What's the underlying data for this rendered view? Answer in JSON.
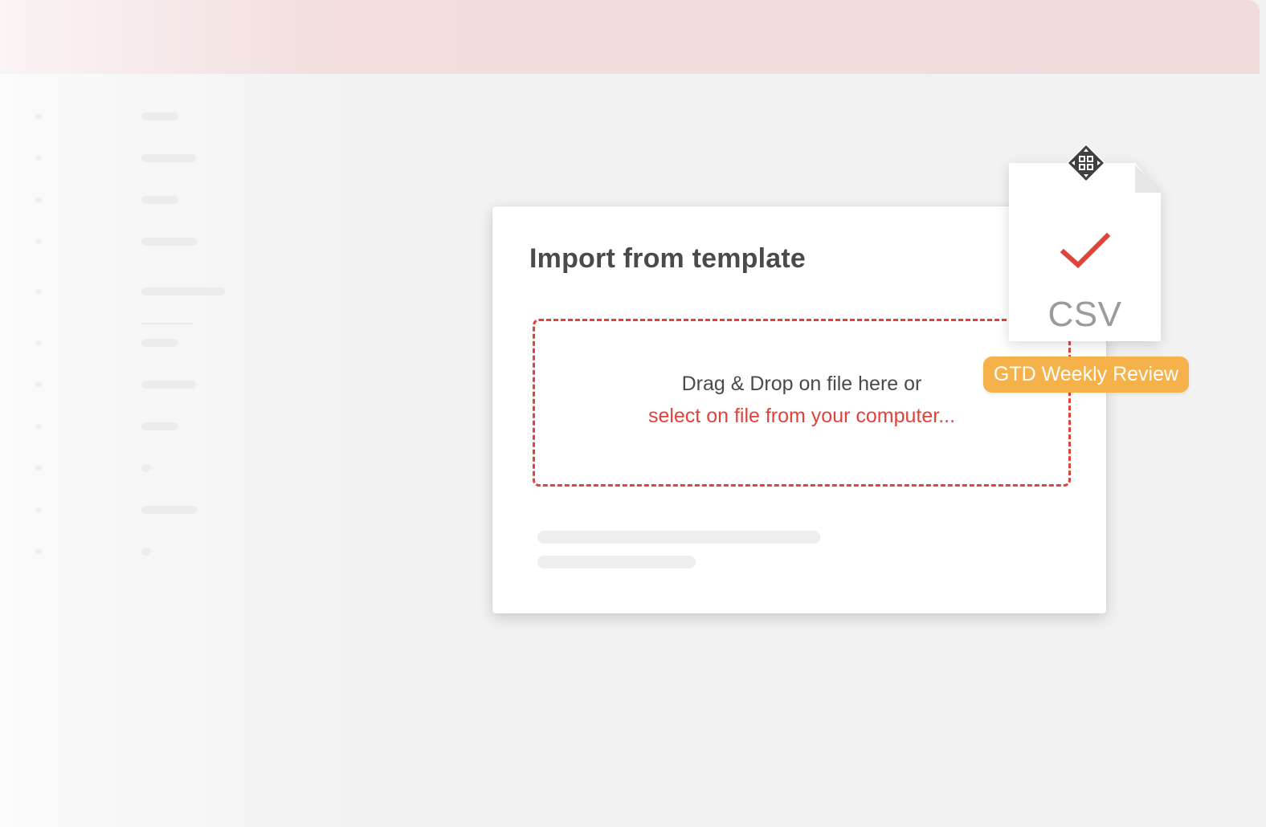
{
  "dialog": {
    "title": "Import from template",
    "drop_prompt": "Drag & Drop on file here or",
    "select_link": "select on file from your computer..."
  },
  "dragged_file": {
    "type_label": "CSV",
    "tag": "GTD Weekly Review",
    "status_icon": "checkmark-icon",
    "cursor_icon": "move-cursor-icon"
  },
  "colors": {
    "accent": "#e1433b",
    "tag": "#f5b24a",
    "header_band": "#f0dcdb",
    "title_text": "#4a4a4a"
  }
}
